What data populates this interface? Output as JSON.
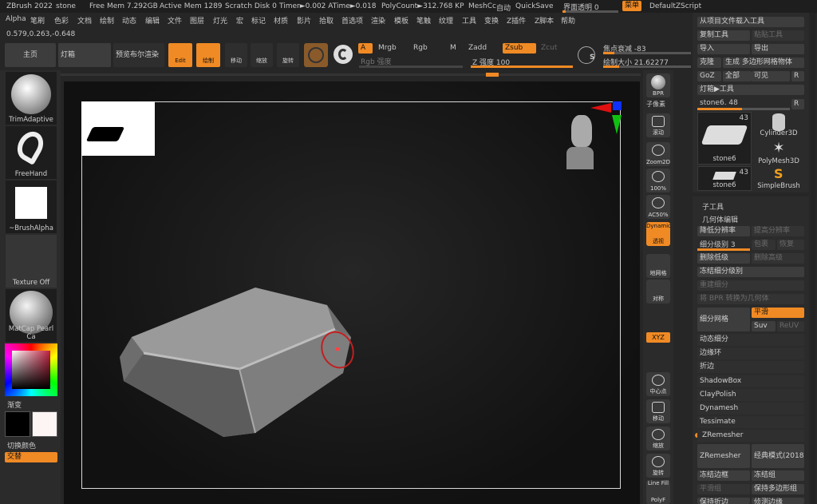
{
  "menubar": {
    "app": "ZBrush 2022",
    "tool": "stone",
    "free_mem": "Free Mem 7.292GB",
    "active_mem": "Active Mem 1289",
    "scratch": "Scratch Disk 0",
    "timer": "Timer►0.002 ATime►0.018",
    "polycount": "PolyCount►312.768 KP",
    "meshcc": "MeshCc",
    "auto": "自动",
    "quicksave": "QuickSave",
    "transparency": "界面透明 0",
    "menu": "菜单",
    "script": "DefaultZScript",
    "items": [
      "Alpha",
      "笔刷",
      "色彩",
      "文档",
      "绘制",
      "动态",
      "编辑",
      "文件",
      "图层",
      "灯光",
      "宏",
      "标记",
      "材质",
      "影片",
      "拾取",
      "首选项",
      "渲染",
      "模板",
      "笔触",
      "纹理",
      "工具",
      "变换",
      "Z插件",
      "Z脚本",
      "帮助"
    ]
  },
  "coords": "0.579,0.263,-0.648",
  "toolbar": {
    "home": "主页",
    "lightbox": "灯箱",
    "bpr_preview": "预览布尔渲染",
    "edit": "Edit",
    "draw": "绘制",
    "move": "移动",
    "scale": "缩放",
    "rotate": "旋转",
    "a": "A",
    "mrgb": "Mrgb",
    "rgb": "Rgb",
    "m": "M",
    "zadd": "Zadd",
    "zsub": "Zsub",
    "zcut": "Zcut",
    "rgb_intensity": "Rgb 强度",
    "z_intensity": "Z 强度 100",
    "z_intensity_value": 1.0,
    "s": "S",
    "focal": "焦点衰减 -83",
    "draw_size": "绘制大小 21.62277"
  },
  "left": {
    "brush": "TrimAdaptive",
    "stroke": "FreeHand",
    "alpha": "~BrushAlpha",
    "texture": "Texture Off",
    "material": "MatCap Pearl Ca",
    "gradient": "渐变",
    "switch_color": "切换颜色",
    "alternate": "交替"
  },
  "right_tools": {
    "bpr": "BPR",
    "subpixel": "子像素",
    "scroll": "滚动",
    "zoom2d": "Zoom2D",
    "pct100": "100%",
    "ac50": "AC50%",
    "dynamic": "Dynamic",
    "persp": "透视",
    "floor": "地网格",
    "local": "对称",
    "xyz": "XYZ",
    "center": "中心点",
    "move": "移动",
    "scale": "缩放",
    "rotate": "旋转",
    "linefill": "Line Fill",
    "polyf": "PolyF"
  },
  "tool_panel": {
    "load": "从项目文件载入工具",
    "copy": "复制工具",
    "paste": "粘贴工具",
    "import": "导入",
    "export": "导出",
    "clone": "克隆",
    "make_polymesh": "生成 多边形网格物体",
    "goz": "GoZ",
    "all": "全部",
    "visible": "可见",
    "r": "R",
    "lightbox_tool": "灯箱▶工具",
    "stone_slider": "stone6. 48",
    "stone_value": 0.48,
    "tiles": [
      {
        "name": "stone6",
        "count": "43"
      },
      {
        "name": "Cylinder3D"
      },
      {
        "name": "PolyMesh3D"
      },
      {
        "name": "stone6",
        "count": "43"
      },
      {
        "name": "SimpleBrush"
      }
    ]
  },
  "subtool": {
    "header": "子工具",
    "geometry": "几何体编辑",
    "lower_res": "降低分辨率",
    "higher_res": "提高分辨率",
    "subdiv_level": "细分级别 3",
    "subdiv_value": 3,
    "cage": "包裹",
    "restore": "恢复",
    "del_lower": "删除低级",
    "del_higher": "删除高级",
    "freeze": "冻结细分级别",
    "reconstruct": "重建细分",
    "bpr_geo": "将 BPR 转换为几何体",
    "divide": "细分网格",
    "smooth": "平滑",
    "suv": "Suv",
    "reuv": "ReUV",
    "list": [
      "动态细分",
      "边缘环",
      "折边",
      "ShadowBox",
      "ClayPolish",
      "Dynamesh",
      "Tessimate",
      "ZRemesher"
    ],
    "zremesher": "ZRemesher",
    "classic": "经典模式(2018)",
    "freeze_border": "冻结边框",
    "freeze_groups": "冻结组",
    "smooth_groups": "平滑组",
    "keep_groups": "保持多边形组",
    "keep_creases": "保持折边",
    "detect_edges": "侦测边缘"
  },
  "colors": {
    "accent": "#f08a24",
    "panel": "#2f2f2f",
    "canvas": "#151515"
  }
}
